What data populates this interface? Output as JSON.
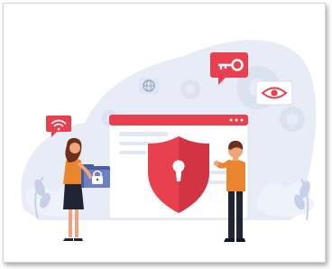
{
  "illustration": {
    "topic": "cyber-security",
    "colors": {
      "accent": "#e8404f",
      "accent_dark": "#c62d3c",
      "backdrop": "#e7ecf7",
      "gear": "#dbe2f0",
      "window": "#f4f6fb",
      "skin": "#f0a37d",
      "hair": "#6b2f1c",
      "person_man_shirt": "#e9852e",
      "person_woman_shirt": "#e9852e",
      "pants": "#1f2533"
    },
    "icons": [
      "shield-keyhole-icon",
      "key-icon",
      "eye-icon",
      "wifi-icon",
      "globe-icon",
      "gear-icon",
      "padlock-icon",
      "cloud-icon",
      "plant-icon"
    ]
  }
}
